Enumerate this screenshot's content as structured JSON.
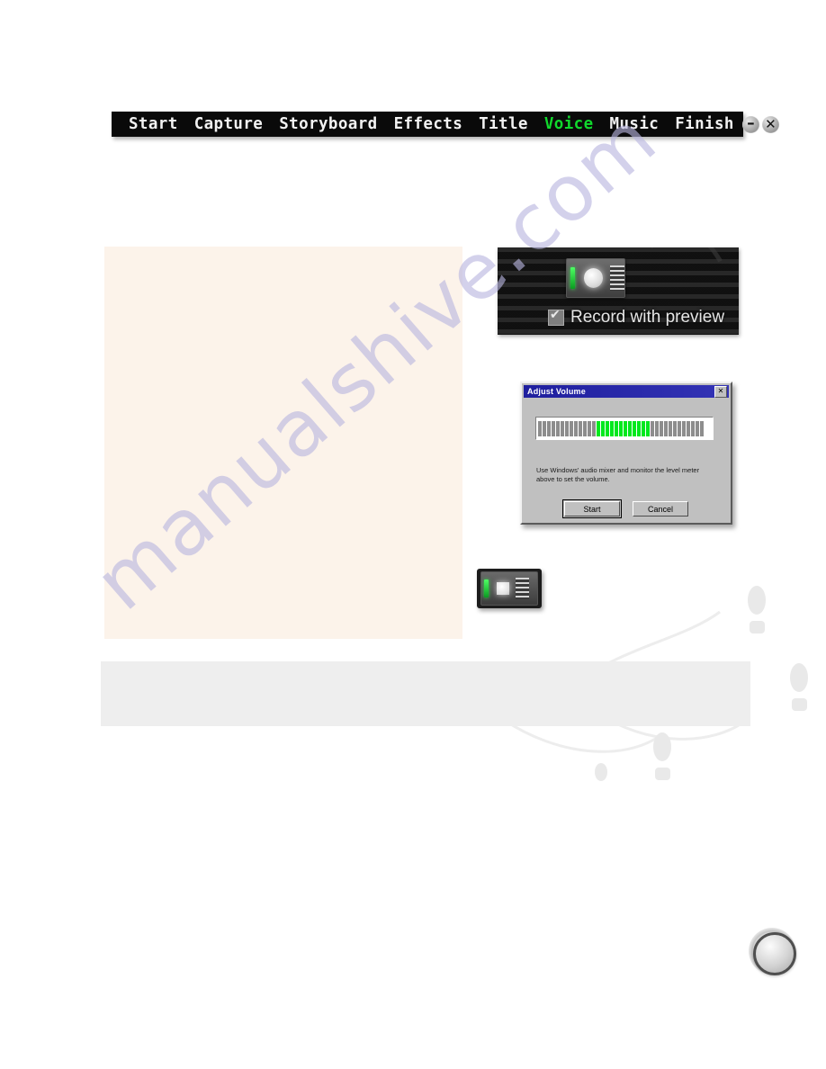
{
  "navbar": {
    "items": [
      {
        "label": "Start",
        "active": false
      },
      {
        "label": "Capture",
        "active": false
      },
      {
        "label": "Storyboard",
        "active": false
      },
      {
        "label": "Effects",
        "active": false
      },
      {
        "label": "Title",
        "active": false
      },
      {
        "label": "Voice",
        "active": true
      },
      {
        "label": "Music",
        "active": false
      },
      {
        "label": "Finish",
        "active": false
      }
    ],
    "active_color": "#10d92c",
    "background_color": "#0a0a0a",
    "text_color": "#f2f2f2",
    "minimize_glyph": "–",
    "close_glyph": "✕"
  },
  "watermark": {
    "text": "manualshive.com",
    "color": "#b9b6e0"
  },
  "panels": {
    "body_panel": {
      "text": "",
      "background_color": "#fcf3ea"
    },
    "note_panel": {
      "text": "",
      "background_color": "#eeeeee"
    }
  },
  "figure_record_panel": {
    "checkbox_label": "Record with preview",
    "checkbox_checked": true,
    "led_color": "#36e04e",
    "background_color": "#141414"
  },
  "figure_adjust_volume": {
    "title": "Adjust Volume",
    "close_glyph": "✕",
    "instruction": "Use Windows' audio mixer and monitor the level meter above to set the volume.",
    "buttons": [
      {
        "label": "Start",
        "accelerator": "S",
        "default": true
      },
      {
        "label": "Cancel",
        "accelerator": "C",
        "default": false
      }
    ],
    "meter": {
      "total_segments": 37,
      "active_from": 13,
      "active_to": 24,
      "active_color": "#00e81e",
      "inactive_color": "#8d8d8d"
    }
  },
  "figure_stop_panel": {
    "state": "stop",
    "led_color": "#36e04e"
  },
  "corner_knob": {
    "shape": "circle"
  }
}
